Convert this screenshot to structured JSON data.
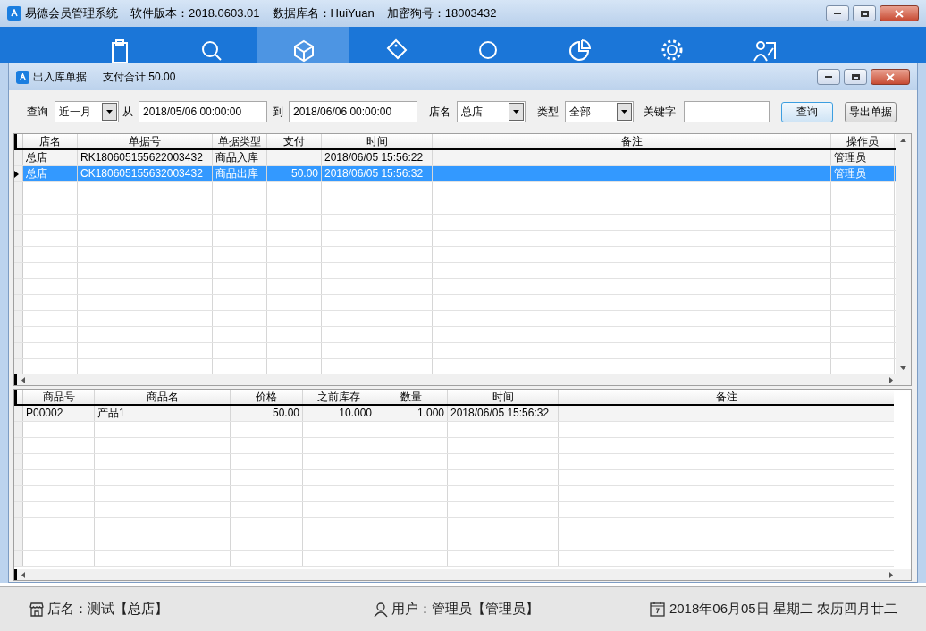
{
  "window": {
    "title": "易德会员管理系统",
    "version": "软件版本：2018.0603.01",
    "database": "数据库名：HuiYuan",
    "dongle": "加密狗号：18003432"
  },
  "nav": [
    {
      "selected": false
    },
    {
      "selected": false
    },
    {
      "selected": true
    },
    {
      "selected": false
    },
    {
      "selected": false
    },
    {
      "selected": false
    },
    {
      "selected": false
    },
    {
      "selected": false
    }
  ],
  "dialog": {
    "title": "出入库单据",
    "total": "支付合计 50.00"
  },
  "filters": {
    "query_label": "查询",
    "range": "近一月",
    "from_label": "从",
    "from": "2018/05/06 00:00:00",
    "to_label": "到",
    "to": "2018/06/06 00:00:00",
    "store_label": "店名",
    "store": "总店",
    "type_label": "类型",
    "type": "全部",
    "keyword_label": "关键字",
    "search_button": "查询",
    "export_button": "导出单据"
  },
  "orders": {
    "columns": [
      "店名",
      "单据号",
      "单据类型",
      "支付",
      "时间",
      "备注",
      "操作员"
    ],
    "rows": [
      {
        "cells": [
          "总店",
          "RK180605155622003432",
          "商品入库",
          "",
          "2018/06/05 15:56:22",
          "",
          "管理员"
        ],
        "selected": false
      },
      {
        "cells": [
          "总店",
          "CK180605155632003432",
          "商品出库",
          "50.00",
          "2018/06/05 15:56:32",
          "",
          "管理员"
        ],
        "selected": true
      }
    ]
  },
  "items": {
    "columns": [
      "商品号",
      "商品名",
      "价格",
      "之前库存",
      "数量",
      "时间",
      "备注"
    ],
    "rows": [
      {
        "cells": [
          "P00002",
          "产品1",
          "50.00",
          "10.000",
          "1.000",
          "2018/06/05 15:56:32",
          ""
        ]
      }
    ]
  },
  "status_bar": {
    "store": "店名：测试【总店】",
    "user": "用户：管理员【管理员】",
    "date": "2018年06月05日 星期二 农历四月廿二"
  }
}
